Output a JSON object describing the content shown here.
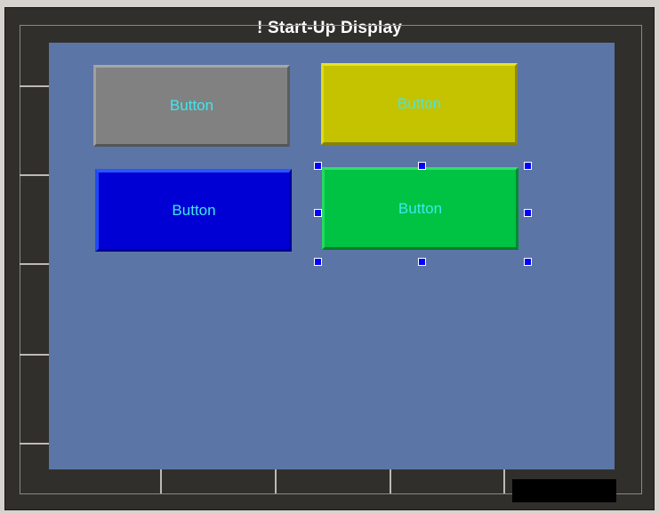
{
  "window": {
    "title": "! Start-Up Display"
  },
  "canvas": {
    "background_color": "#5b75a6",
    "buttons": [
      {
        "label": "Button",
        "color": "#818181",
        "color_name": "gray"
      },
      {
        "label": "Button",
        "color": "#c5c200",
        "color_name": "yellow"
      },
      {
        "label": "Button",
        "color": "#0000d4",
        "color_name": "blue"
      },
      {
        "label": "Button",
        "color": "#00c243",
        "color_name": "green",
        "selected": true
      }
    ],
    "label_color": "#3fe8ee",
    "selection_handle_color": "#0000ff"
  }
}
